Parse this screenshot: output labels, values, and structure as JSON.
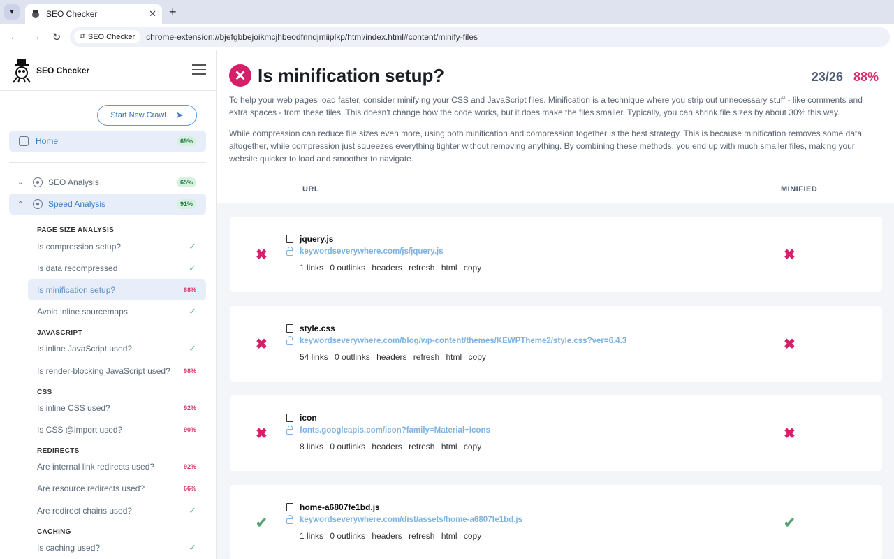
{
  "browser": {
    "tab_title": "SEO Checker",
    "tab_close": "✕",
    "new_tab": "+",
    "chip_label": "SEO Checker",
    "url": "chrome-extension://bjefgbbejoikmcjhbeodfnndjmiiplkp/html/index.html#content/minify-files"
  },
  "sidebar": {
    "brand": "SEO Checker",
    "crawl_button": "Start New Crawl",
    "home": {
      "label": "Home",
      "badge": "69%"
    },
    "sections": [
      {
        "label": "SEO Analysis",
        "badge": "65%"
      },
      {
        "label": "Speed Analysis",
        "badge": "91%"
      }
    ],
    "groups": [
      {
        "title": "PAGE SIZE ANALYSIS"
      },
      {
        "title": "JAVASCRIPT"
      },
      {
        "title": "CSS"
      },
      {
        "title": "REDIRECTS"
      },
      {
        "title": "CACHING"
      }
    ],
    "items": [
      {
        "label": "Is compression setup?",
        "status": "✓"
      },
      {
        "label": "Is data recompressed",
        "status": "✓"
      },
      {
        "label": "Is minification setup?",
        "status": "88%"
      },
      {
        "label": "Avoid inline sourcemaps",
        "status": "✓"
      },
      {
        "label": "Is inline JavaScript used?",
        "status": "✓"
      },
      {
        "label": "Is render-blocking JavaScript used?",
        "status": "98%"
      },
      {
        "label": "Is inline CSS used?",
        "status": "92%"
      },
      {
        "label": "Is CSS @import used?",
        "status": "90%"
      },
      {
        "label": "Are internal link redirects used?",
        "status": "92%"
      },
      {
        "label": "Are resource redirects used?",
        "status": "66%"
      },
      {
        "label": "Are redirect chains used?",
        "status": "✓"
      },
      {
        "label": "Is caching used?",
        "status": "✓"
      }
    ]
  },
  "main": {
    "title": "Is minification setup?",
    "score_fraction": "23/26",
    "score_percent": "88%",
    "description_1": "To help your web pages load faster, consider minifying your CSS and JavaScript files. Minification is a technique where you strip out unnecessary stuff - like comments and extra spaces - from these files. This doesn't change how the code works, but it does make the files smaller. Typically, you can shrink file sizes by about 30% this way.",
    "description_2": "While compression can reduce file sizes even more, using both minification and compression together is the best strategy. This is because minification removes some data altogether, while compression just squeezes everything tighter without removing anything. By combining these methods, you end up with much smaller files, making your website quicker to load and smoother to navigate.",
    "columns": {
      "url": "URL",
      "minified": "MINIFIED"
    },
    "rows": [
      {
        "name": "jquery.js",
        "url": "keywordseverywhere.com/js/jquery.js",
        "links": "1 links",
        "outlinks": "0 outlinks",
        "status": "fail",
        "minified": "fail"
      },
      {
        "name": "style.css",
        "url": "keywordseverywhere.com/blog/wp-content/themes/KEWPTheme2/style.css?ver=6.4.3",
        "links": "54 links",
        "outlinks": "0 outlinks",
        "status": "fail",
        "minified": "fail"
      },
      {
        "name": "icon",
        "url": "fonts.googleapis.com/icon?family=Material+Icons",
        "links": "8 links",
        "outlinks": "0 outlinks",
        "status": "fail",
        "minified": "fail"
      },
      {
        "name": "home-a6807fe1bd.js",
        "url": "keywordseverywhere.com/dist/assets/home-a6807fe1bd.js",
        "links": "1 links",
        "outlinks": "0 outlinks",
        "status": "pass",
        "minified": "pass"
      }
    ],
    "row_actions": {
      "headers": "headers",
      "refresh": "refresh",
      "html": "html",
      "copy": "copy"
    },
    "marks": {
      "fail": "✖",
      "pass": "✔"
    }
  }
}
